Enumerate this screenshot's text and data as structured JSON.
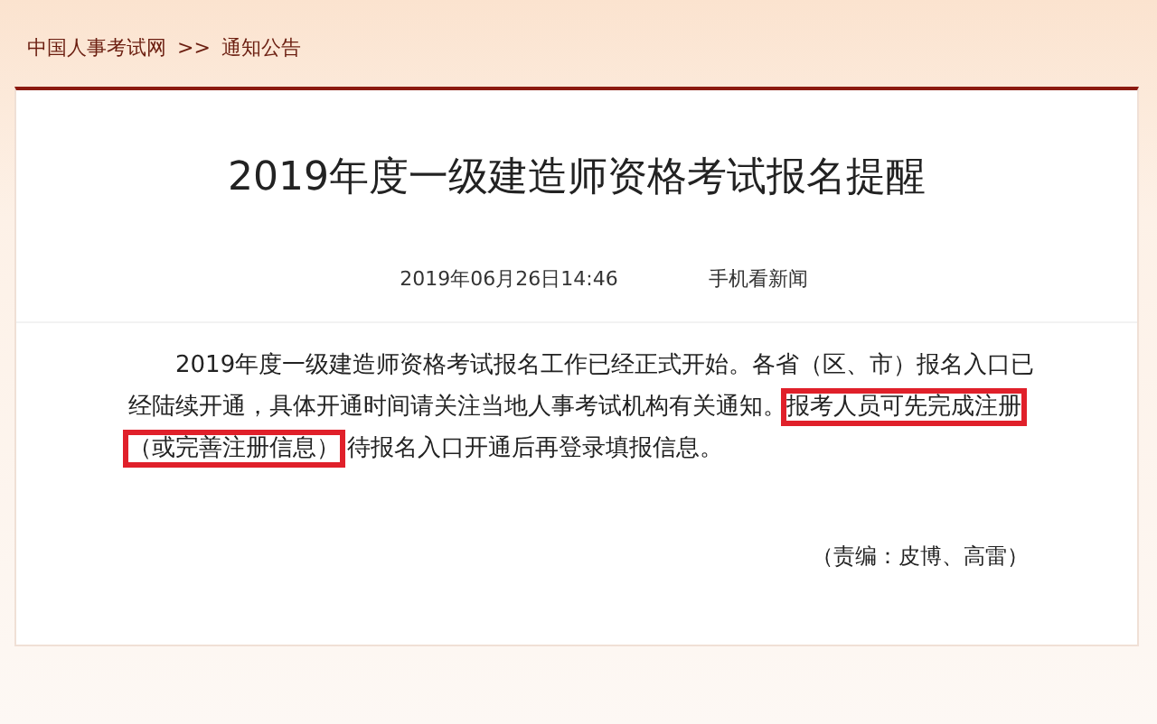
{
  "breadcrumb": [
    {
      "label": "中国人事考试网"
    },
    {
      "label": ">>"
    },
    {
      "label": "通知公告"
    }
  ],
  "article": {
    "title": "2019年度一级建造师资格考试报名提醒",
    "date": "2019年06月26日14:46",
    "mobile_link": "手机看新闻",
    "paragraph": [
      {
        "text": "2019年度一级建造师资格考试报名工作已经正式开始。各省（区、市）报名入口已经陆续开通，具体开通时间请关注当地人事考试机构有关通知。",
        "highlighted": false
      },
      {
        "text": "报考人员可先完成注册",
        "highlighted": true
      },
      {
        "text": "（或完善注册信息）",
        "highlighted": true
      },
      {
        "text": " 待报名入口开通后再登录填报信息。",
        "highlighted": false
      }
    ],
    "editors": "（责编：皮博、高雷）"
  }
}
